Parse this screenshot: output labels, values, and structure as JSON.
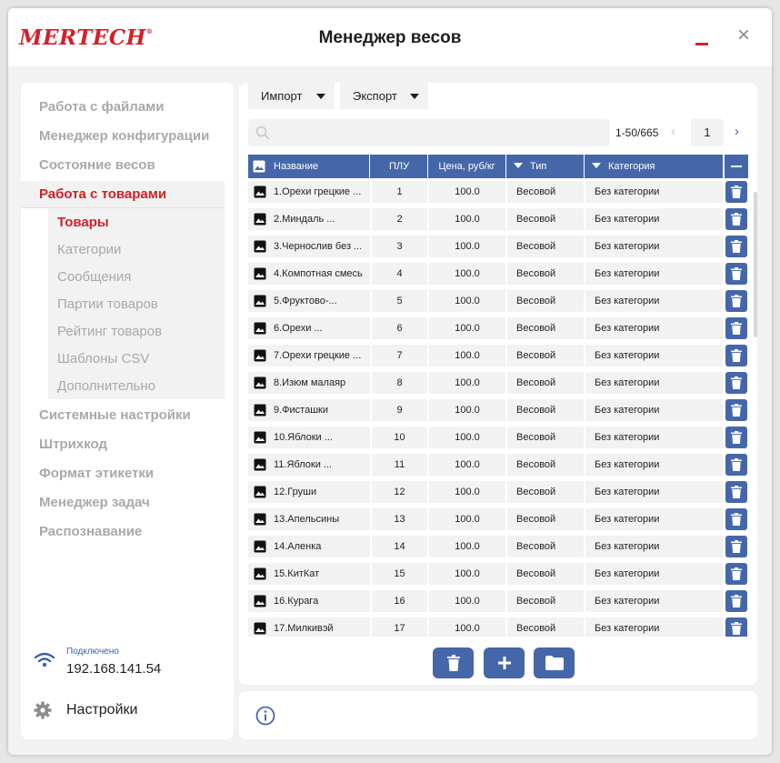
{
  "app": {
    "logo": "MERTECH",
    "logo_mark": "®",
    "title": "Менеджер весов",
    "minimize_icon": "minimize-icon",
    "close_symbol": "×",
    "accent_color": "#d32027",
    "primary_color": "#4567aa"
  },
  "sidebar": {
    "items": [
      {
        "label": "Работа с файлами"
      },
      {
        "label": "Менеджер конфигурации"
      },
      {
        "label": "Состояние весов"
      },
      {
        "label": "Работа с товарами",
        "active": true
      },
      {
        "label": "Системные настройки"
      },
      {
        "label": "Штрихкод"
      },
      {
        "label": "Формат этикетки"
      },
      {
        "label": "Менеджер задач"
      },
      {
        "label": "Распознавание"
      }
    ],
    "subitems": [
      {
        "label": "Товары",
        "active": true
      },
      {
        "label": "Категории"
      },
      {
        "label": "Сообщения"
      },
      {
        "label": "Партии товаров"
      },
      {
        "label": "Рейтинг товаров"
      },
      {
        "label": "Шаблоны CSV"
      },
      {
        "label": "Дополнительно"
      }
    ],
    "connection": {
      "label": "Подключено",
      "ip": "192.168.141.54",
      "icon": "wifi-icon"
    },
    "settings": {
      "label": "Настройки",
      "icon": "gear-icon"
    }
  },
  "toolbar": {
    "import_label": "Импорт",
    "export_label": "Экспорт",
    "search_placeholder": "",
    "search_value": "",
    "search_icon": "search-icon"
  },
  "pager": {
    "range": "1-50/665",
    "page": "1",
    "prev": "‹",
    "next": "›"
  },
  "table": {
    "columns": {
      "name": "Название",
      "plu": "ПЛУ",
      "price": "Цена, руб/кг",
      "type": "Тип",
      "category": "Категория"
    },
    "rows": [
      {
        "name": "1.Орехи грецкие ...",
        "plu": "1",
        "price": "100.0",
        "type": "Весовой",
        "category": "Без категории"
      },
      {
        "name": "2.Миндаль ...",
        "plu": "2",
        "price": "100.0",
        "type": "Весовой",
        "category": "Без категории"
      },
      {
        "name": "3.Чернослив без ...",
        "plu": "3",
        "price": "100.0",
        "type": "Весовой",
        "category": "Без категории"
      },
      {
        "name": "4.Компотная смесь",
        "plu": "4",
        "price": "100.0",
        "type": "Весовой",
        "category": "Без категории"
      },
      {
        "name": "5.Фруктово-...",
        "plu": "5",
        "price": "100.0",
        "type": "Весовой",
        "category": "Без категории"
      },
      {
        "name": "6.Орехи ...",
        "plu": "6",
        "price": "100.0",
        "type": "Весовой",
        "category": "Без категории"
      },
      {
        "name": "7.Орехи грецкие ...",
        "plu": "7",
        "price": "100.0",
        "type": "Весовой",
        "category": "Без категории"
      },
      {
        "name": "8.Изюм малаяр",
        "plu": "8",
        "price": "100.0",
        "type": "Весовой",
        "category": "Без категории"
      },
      {
        "name": "9.Фисташки",
        "plu": "9",
        "price": "100.0",
        "type": "Весовой",
        "category": "Без категории"
      },
      {
        "name": "10.Яблоки ...",
        "plu": "10",
        "price": "100.0",
        "type": "Весовой",
        "category": "Без категории"
      },
      {
        "name": "11.Яблоки ...",
        "plu": "11",
        "price": "100.0",
        "type": "Весовой",
        "category": "Без категории"
      },
      {
        "name": "12.Груши",
        "plu": "12",
        "price": "100.0",
        "type": "Весовой",
        "category": "Без категории"
      },
      {
        "name": "13.Апельсины",
        "plu": "13",
        "price": "100.0",
        "type": "Весовой",
        "category": "Без категории"
      },
      {
        "name": "14.Аленка",
        "plu": "14",
        "price": "100.0",
        "type": "Весовой",
        "category": "Без категории"
      },
      {
        "name": "15.КитКат",
        "plu": "15",
        "price": "100.0",
        "type": "Весовой",
        "category": "Без категории"
      },
      {
        "name": "16.Курага",
        "plu": "16",
        "price": "100.0",
        "type": "Весовой",
        "category": "Без категории"
      },
      {
        "name": "17.Милкивэй",
        "plu": "17",
        "price": "100.0",
        "type": "Весовой",
        "category": "Без категории"
      }
    ]
  },
  "actions": [
    {
      "name": "delete-all-button",
      "icon": "trash-icon"
    },
    {
      "name": "add-product-button",
      "icon": "plus-icon"
    },
    {
      "name": "open-folder-button",
      "icon": "folder-icon"
    }
  ],
  "infobar": {
    "icon": "info-icon"
  }
}
